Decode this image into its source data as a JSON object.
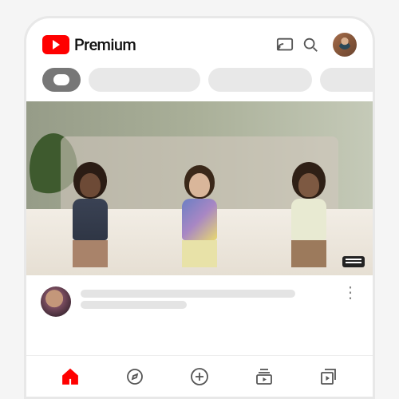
{
  "brand": {
    "name": "Premium",
    "logo_color": "#ff0000"
  },
  "header": {
    "cast_icon": "cast-icon",
    "search_icon": "search-icon",
    "account_icon": "account-avatar"
  },
  "chips": [
    {
      "label": "",
      "active": true
    },
    {
      "label": "",
      "active": false
    },
    {
      "label": "",
      "active": false
    },
    {
      "label": "",
      "active": false
    }
  ],
  "feed": [
    {
      "thumbnail": "music-video-scene",
      "channel_avatar": "channel-avatar",
      "title_placeholder": "",
      "subtitle_placeholder": ""
    }
  ],
  "nav": {
    "items": [
      {
        "id": "home",
        "label": "Home",
        "active": true
      },
      {
        "id": "explore",
        "label": "Explore",
        "active": false
      },
      {
        "id": "create",
        "label": "Create",
        "active": false
      },
      {
        "id": "subscriptions",
        "label": "Subscriptions",
        "active": false
      },
      {
        "id": "library",
        "label": "Library",
        "active": false
      }
    ]
  }
}
